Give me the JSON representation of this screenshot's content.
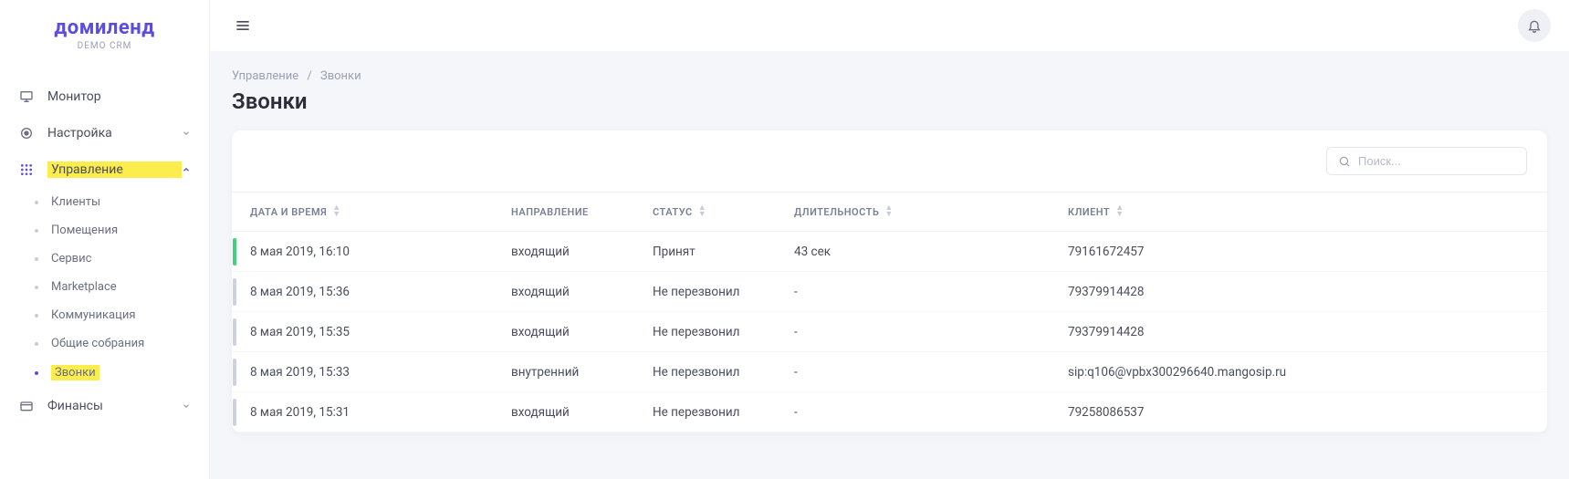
{
  "brand": {
    "name": "домиленд",
    "sub": "DEMO CRM"
  },
  "sidebar": {
    "items": [
      {
        "label": "Монитор"
      },
      {
        "label": "Настройка"
      },
      {
        "label": "Управление"
      },
      {
        "label": "Финансы"
      }
    ],
    "management_sub": [
      {
        "label": "Клиенты"
      },
      {
        "label": "Помещения"
      },
      {
        "label": "Сервис"
      },
      {
        "label": "Marketplace"
      },
      {
        "label": "Коммуникация"
      },
      {
        "label": "Общие собрания"
      },
      {
        "label": "Звонки"
      }
    ]
  },
  "breadcrumb": {
    "root": "Управление",
    "leaf": "Звонки"
  },
  "page_title": "Звонки",
  "search": {
    "placeholder": "Поиск..."
  },
  "table": {
    "headers": {
      "datetime": "ДАТА И ВРЕМЯ",
      "direction": "НАПРАВЛЕНИЕ",
      "status": "СТАТУС",
      "duration": "ДЛИТЕЛЬНОСТЬ",
      "client": "КЛИЕНТ"
    },
    "rows": [
      {
        "bar": "green",
        "datetime": "8 мая 2019, 16:10",
        "direction": "входящий",
        "status": "Принят",
        "duration": "43 сек",
        "client": "79161672457"
      },
      {
        "bar": "gray",
        "datetime": "8 мая 2019, 15:36",
        "direction": "входящий",
        "status": "Не перезвонил",
        "duration": "-",
        "client": "79379914428"
      },
      {
        "bar": "gray",
        "datetime": "8 мая 2019, 15:35",
        "direction": "входящий",
        "status": "Не перезвонил",
        "duration": "-",
        "client": "79379914428"
      },
      {
        "bar": "gray",
        "datetime": "8 мая 2019, 15:33",
        "direction": "внутренний",
        "status": "Не перезвонил",
        "duration": "-",
        "client": "sip:q106@vpbx300296640.mangosip.ru"
      },
      {
        "bar": "gray",
        "datetime": "8 мая 2019, 15:31",
        "direction": "входящий",
        "status": "Не перезвонил",
        "duration": "-",
        "client": "79258086537"
      }
    ]
  }
}
